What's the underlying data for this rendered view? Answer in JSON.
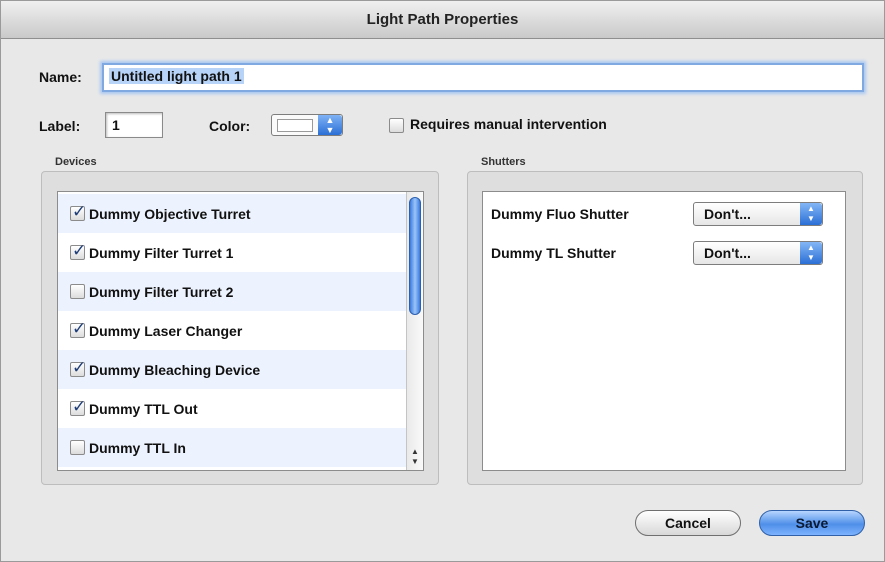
{
  "window": {
    "title": "Light Path Properties"
  },
  "form": {
    "name_label": "Name:",
    "name_value": "Untitled light path 1",
    "label_label": "Label:",
    "label_value": "1",
    "color_label": "Color:",
    "manual_label": "Requires manual intervention",
    "manual_checked": false
  },
  "devices": {
    "title": "Devices",
    "items": [
      {
        "label": "Dummy Objective Turret",
        "checked": true
      },
      {
        "label": "Dummy Filter Turret 1",
        "checked": true
      },
      {
        "label": "Dummy Filter Turret 2",
        "checked": false
      },
      {
        "label": "Dummy Laser Changer",
        "checked": true
      },
      {
        "label": "Dummy Bleaching Device",
        "checked": true
      },
      {
        "label": "Dummy TTL Out",
        "checked": true
      },
      {
        "label": "Dummy TTL In",
        "checked": false
      }
    ]
  },
  "shutters": {
    "title": "Shutters",
    "items": [
      {
        "label": "Dummy Fluo Shutter",
        "value": "Don't..."
      },
      {
        "label": "Dummy TL Shutter",
        "value": "Don't..."
      }
    ]
  },
  "buttons": {
    "cancel": "Cancel",
    "save": "Save"
  },
  "icons": {
    "checkbox": "checkbox-icon",
    "stepper": "popup-stepper-icon",
    "scroll": "scroll-arrows-icon"
  },
  "colors": {
    "accent": "#3a7be0",
    "selection": "#b7d3f8",
    "alt_row": "#edf3fe"
  }
}
